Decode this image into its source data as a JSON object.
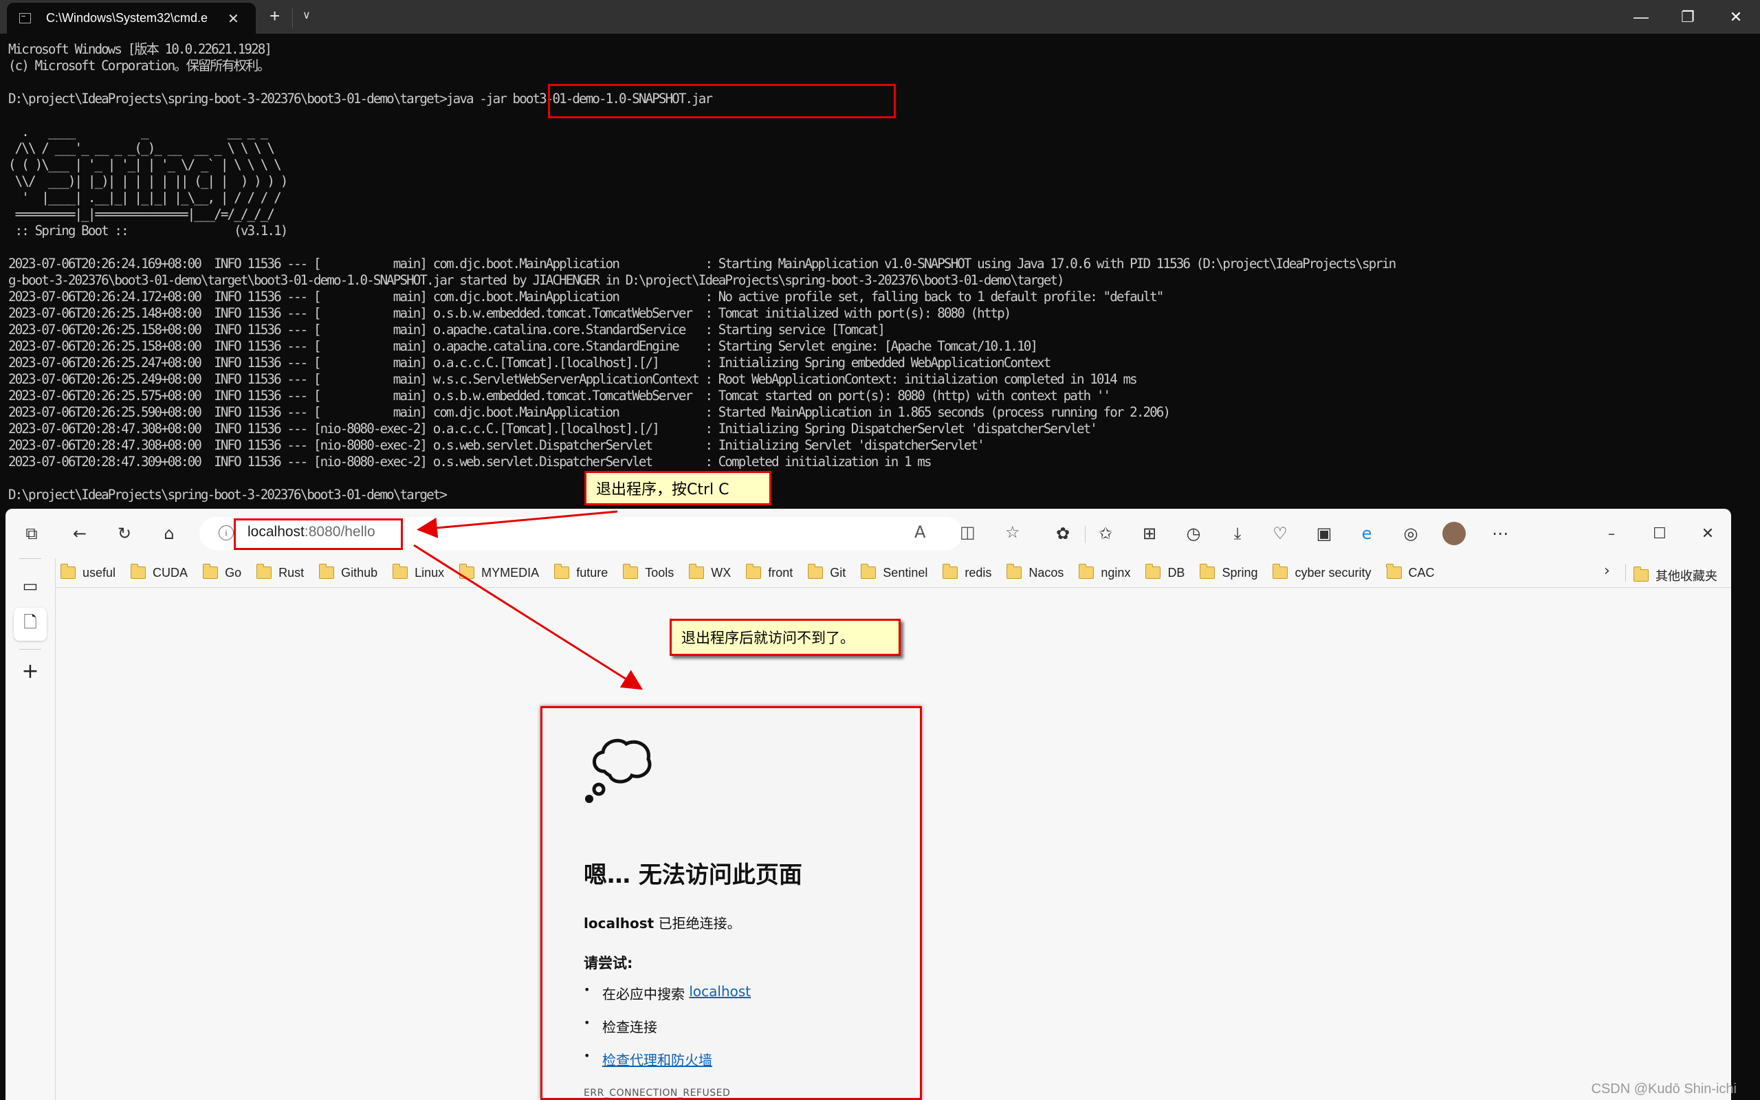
{
  "terminal": {
    "tab_title": "C:\\Windows\\System32\\cmd.e",
    "window_controls": {
      "minimize": "—",
      "maximize": "❐",
      "close": "✕"
    },
    "lines": [
      "Microsoft Windows [版本 10.0.22621.1928]",
      "(c) Microsoft Corporation。保留所有权利。",
      "",
      "D:\\project\\IdeaProjects\\spring-boot-3-202376\\boot3-01-demo\\target>java -jar boot3-01-demo-1.0-SNAPSHOT.jar",
      "",
      "  .   ____          _            __ _ _",
      " /\\\\ / ___'_ __ _ _(_)_ __  __ _ \\ \\ \\ \\",
      "( ( )\\___ | '_ | '_| | '_ \\/ _` | \\ \\ \\ \\",
      " \\\\/  ___)| |_)| | | | | || (_| |  ) ) ) )",
      "  '  |____| .__|_| |_|_| |_\\__, | / / / /",
      " =========|_|==============|___/=/_/_/_/",
      " :: Spring Boot ::                (v3.1.1)",
      "",
      "2023-07-06T20:26:24.169+08:00  INFO 11536 --- [           main] com.djc.boot.MainApplication             : Starting MainApplication v1.0-SNAPSHOT using Java 17.0.6 with PID 11536 (D:\\project\\IdeaProjects\\sprin",
      "g-boot-3-202376\\boot3-01-demo\\target\\boot3-01-demo-1.0-SNAPSHOT.jar started by JIACHENGER in D:\\project\\IdeaProjects\\spring-boot-3-202376\\boot3-01-demo\\target)",
      "2023-07-06T20:26:24.172+08:00  INFO 11536 --- [           main] com.djc.boot.MainApplication             : No active profile set, falling back to 1 default profile: \"default\"",
      "2023-07-06T20:26:25.148+08:00  INFO 11536 --- [           main] o.s.b.w.embedded.tomcat.TomcatWebServer  : Tomcat initialized with port(s): 8080 (http)",
      "2023-07-06T20:26:25.158+08:00  INFO 11536 --- [           main] o.apache.catalina.core.StandardService   : Starting service [Tomcat]",
      "2023-07-06T20:26:25.158+08:00  INFO 11536 --- [           main] o.apache.catalina.core.StandardEngine    : Starting Servlet engine: [Apache Tomcat/10.1.10]",
      "2023-07-06T20:26:25.247+08:00  INFO 11536 --- [           main] o.a.c.c.C.[Tomcat].[localhost].[/]       : Initializing Spring embedded WebApplicationContext",
      "2023-07-06T20:26:25.249+08:00  INFO 11536 --- [           main] w.s.c.ServletWebServerApplicationContext : Root WebApplicationContext: initialization completed in 1014 ms",
      "2023-07-06T20:26:25.575+08:00  INFO 11536 --- [           main] o.s.b.w.embedded.tomcat.TomcatWebServer  : Tomcat started on port(s): 8080 (http) with context path ''",
      "2023-07-06T20:26:25.590+08:00  INFO 11536 --- [           main] com.djc.boot.MainApplication             : Started MainApplication in 1.865 seconds (process running for 2.206)",
      "2023-07-06T20:28:47.308+08:00  INFO 11536 --- [nio-8080-exec-2] o.a.c.c.C.[Tomcat].[localhost].[/]       : Initializing Spring DispatcherServlet 'dispatcherServlet'",
      "2023-07-06T20:28:47.308+08:00  INFO 11536 --- [nio-8080-exec-2] o.s.web.servlet.DispatcherServlet        : Initializing Servlet 'dispatcherServlet'",
      "2023-07-06T20:28:47.309+08:00  INFO 11536 --- [nio-8080-exec-2] o.s.web.servlet.DispatcherServlet        : Completed initialization in 1 ms",
      "",
      "D:\\project\\IdeaProjects\\spring-boot-3-202376\\boot3-01-demo\\target>"
    ]
  },
  "annotations": {
    "ctrl_c_note": "退出程序，按Ctrl C",
    "unreachable_note": "退出程序后就访问不到了。",
    "annotation_color": "#e50000",
    "callout_bg": "#ffffc4"
  },
  "browser": {
    "address": {
      "host": "localhost",
      "rest": ":8080/hello"
    },
    "toolbar_icons": [
      "tab-actions-icon",
      "back-icon",
      "refresh-icon",
      "home-icon",
      "read-aloud-icon",
      "split-screen-icon",
      "favorite-star-icon",
      "extensions-icon",
      "favorites-icon",
      "collections-icon",
      "history-icon",
      "downloads-icon",
      "browser-essentials-icon",
      "math-solver-icon",
      "ie-mode-icon",
      "screenshot-icon",
      "profile-avatar",
      "more-icon"
    ],
    "window_controls": {
      "minimize": "–",
      "maximize": "☐",
      "close": "✕"
    },
    "bookmarks": [
      "useful",
      "CUDA",
      "Go",
      "Rust",
      "Github",
      "Linux",
      "MYMEDIA",
      "future",
      "Tools",
      "WX",
      "front",
      "Git",
      "Sentinel",
      "redis",
      "Nacos",
      "nginx",
      "DB",
      "Spring",
      "cyber security",
      "CAC"
    ],
    "bookmarks_overflow": "›",
    "other_favorites": "其他收藏夹",
    "error_page": {
      "title": "嗯… 无法访问此页面",
      "host": "localhost",
      "refused": " 已拒绝连接。",
      "try_heading": "请尝试:",
      "suggestions": [
        {
          "text": "在必应中搜索 ",
          "link": "localhost"
        },
        {
          "text": "检查连接",
          "link": ""
        },
        {
          "text": "",
          "link": "检查代理和防火墙"
        }
      ],
      "error_code": "ERR_CONNECTION_REFUSED",
      "link_color": "#0e61b4"
    }
  },
  "watermark": "CSDN @Kudō Shin-ichi"
}
